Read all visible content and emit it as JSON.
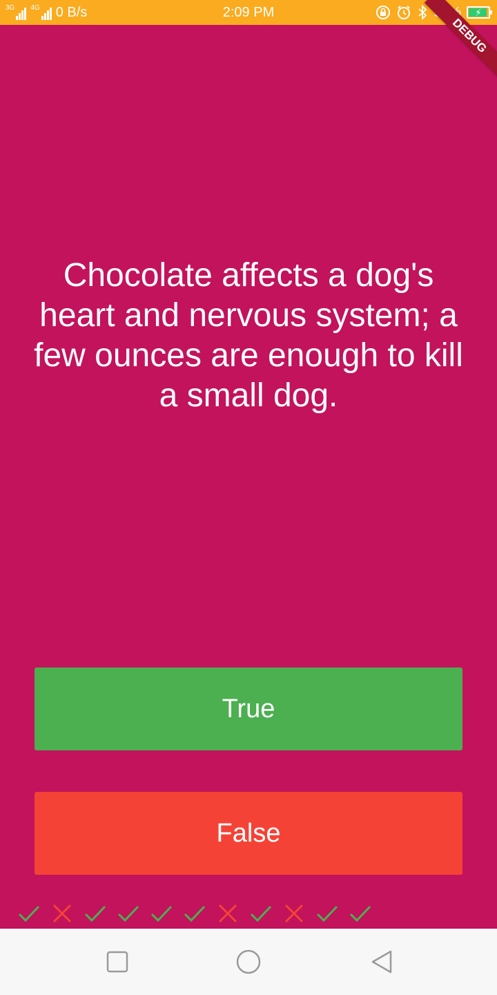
{
  "status_bar": {
    "network_left": "3G",
    "network_right": "4G",
    "data_speed": "0 B/s",
    "time": "2:09 PM",
    "battery_percent": "97%",
    "battery_level": 0.97,
    "icons": [
      "signal-icon",
      "signal-icon",
      "rotation-lock-icon",
      "alarm-icon",
      "bluetooth-icon",
      "battery-charging-icon"
    ]
  },
  "debug_banner": "DEBUG",
  "quiz": {
    "question": "Chocolate affects a dog's heart and nervous system; a few ounces are enough to kill a small dog.",
    "true_label": "True",
    "false_label": "False",
    "true_color": "#4caf50",
    "false_color": "#f44336",
    "background_color": "#c2135c"
  },
  "score_keeper": [
    {
      "result": "correct",
      "icon": "check-icon"
    },
    {
      "result": "wrong",
      "icon": "close-icon"
    },
    {
      "result": "correct",
      "icon": "check-icon"
    },
    {
      "result": "correct",
      "icon": "check-icon"
    },
    {
      "result": "correct",
      "icon": "check-icon"
    },
    {
      "result": "correct",
      "icon": "check-icon"
    },
    {
      "result": "wrong",
      "icon": "close-icon"
    },
    {
      "result": "correct",
      "icon": "check-icon"
    },
    {
      "result": "wrong",
      "icon": "close-icon"
    },
    {
      "result": "correct",
      "icon": "check-icon"
    },
    {
      "result": "correct",
      "icon": "check-icon"
    }
  ],
  "nav_bar": {
    "buttons": [
      "recents-icon",
      "home-icon",
      "back-icon"
    ]
  }
}
